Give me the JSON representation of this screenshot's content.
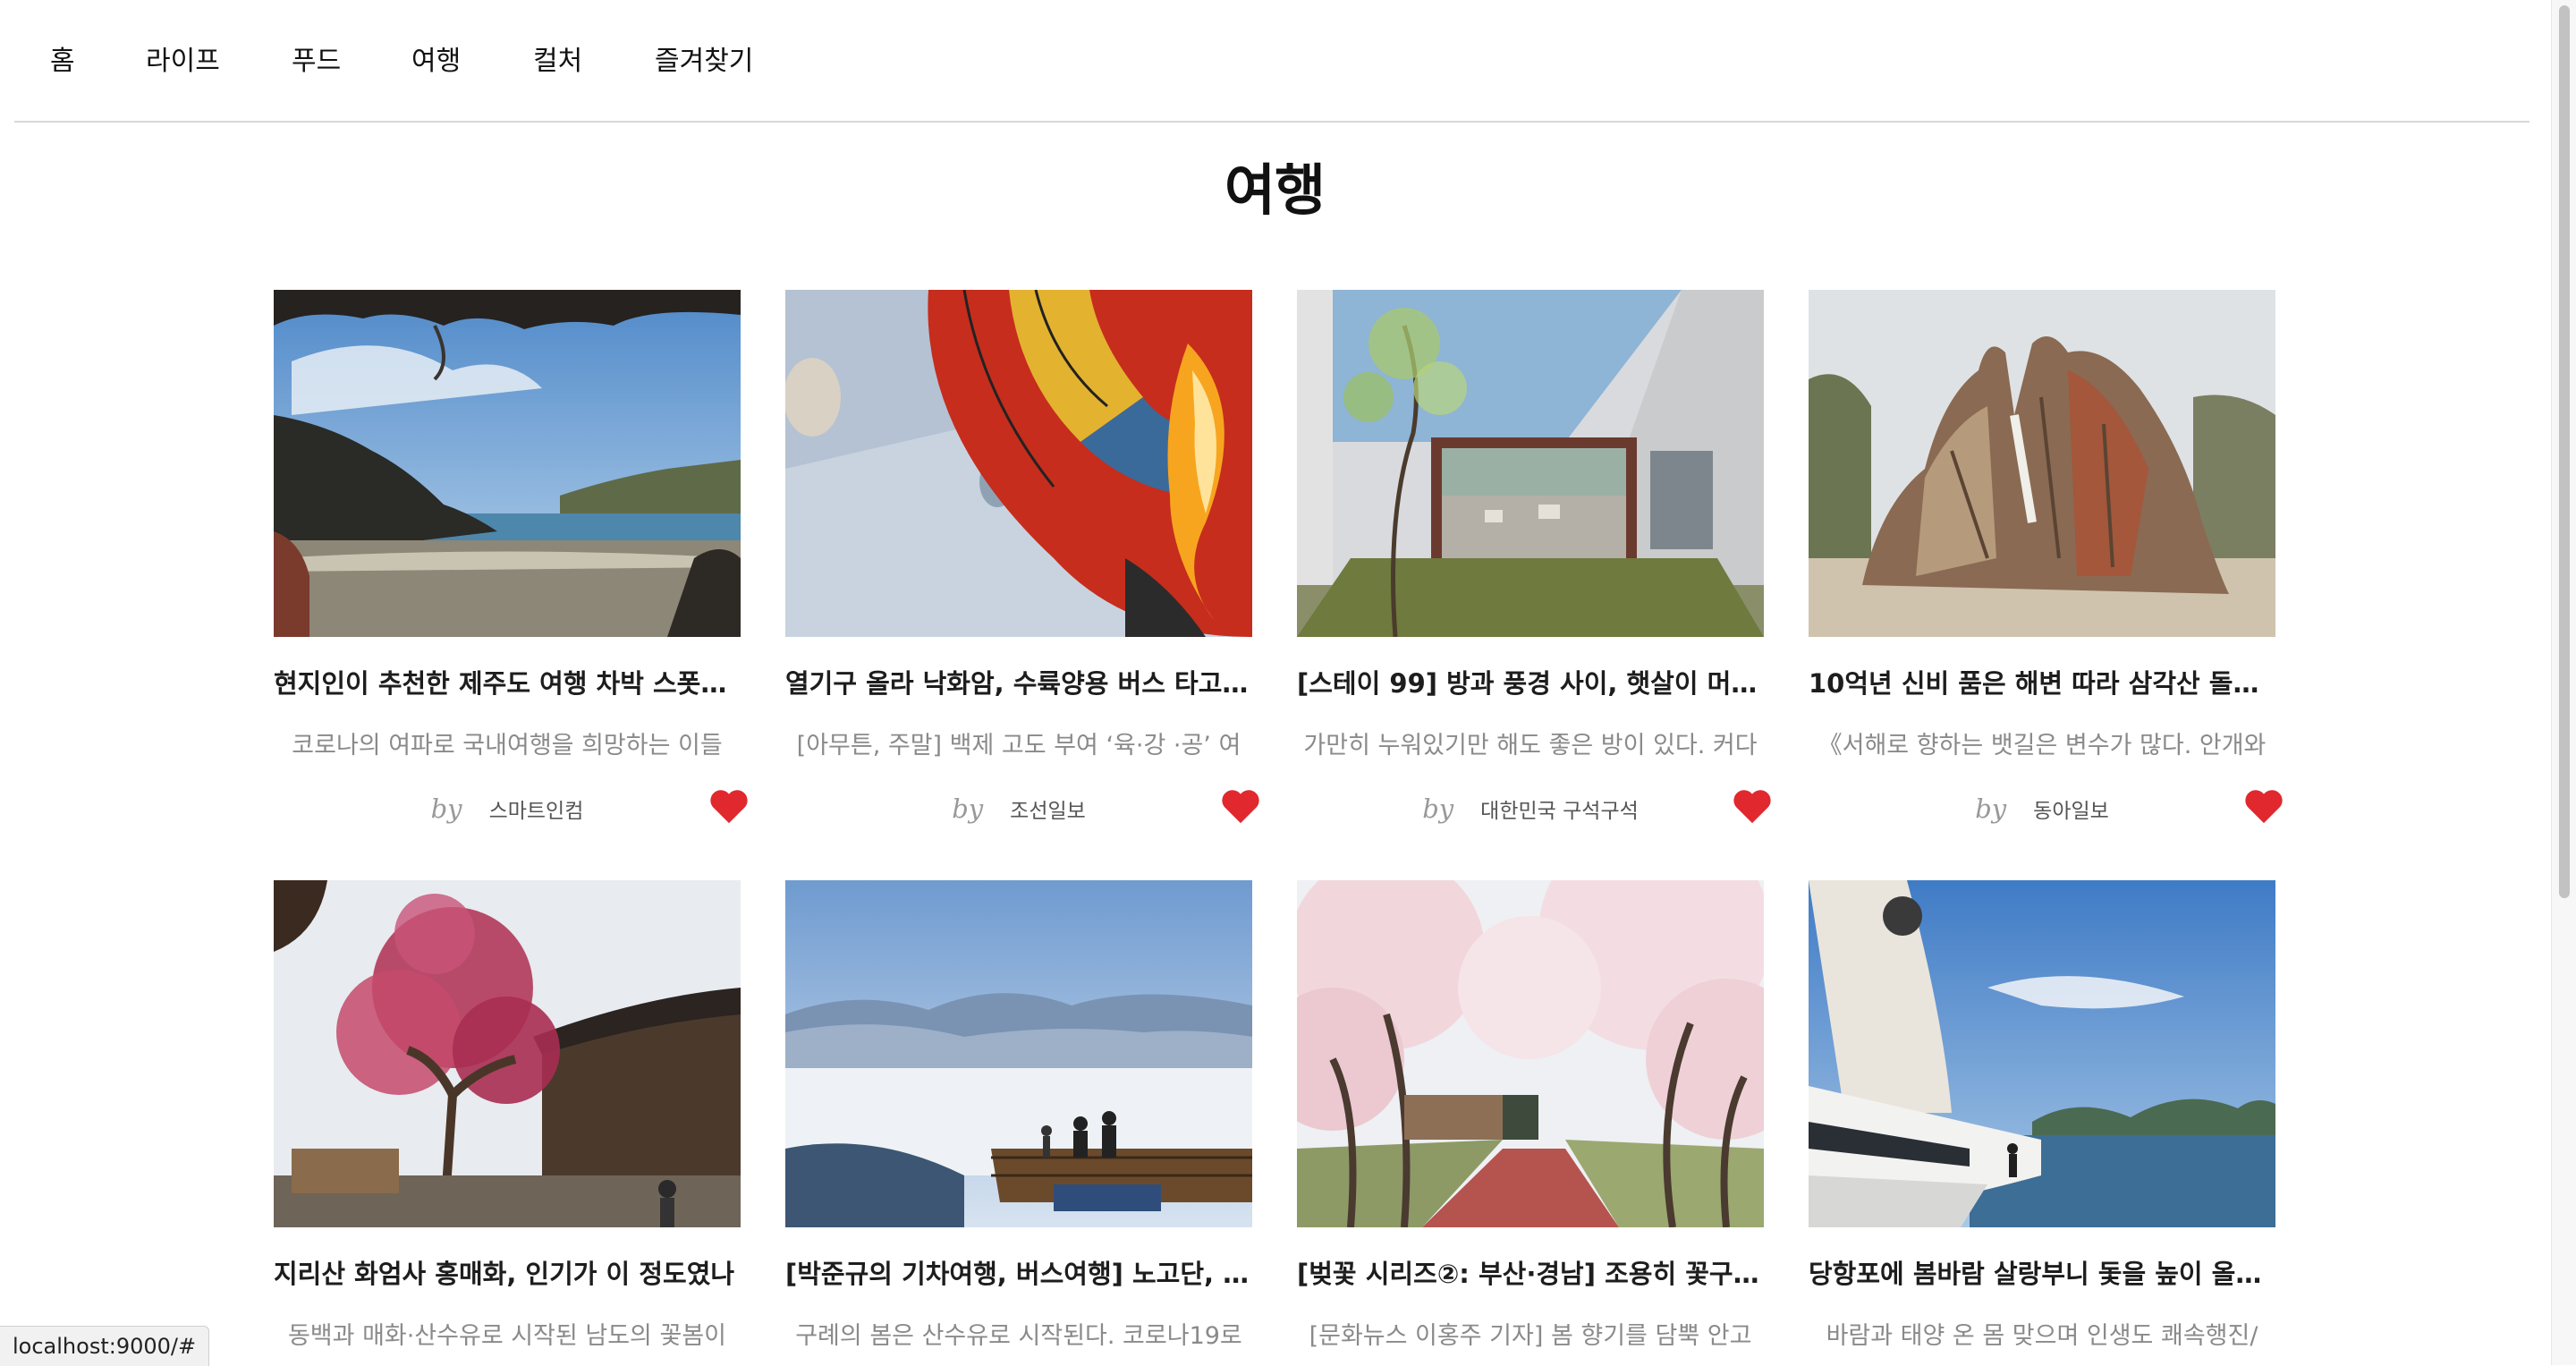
{
  "nav": {
    "items": [
      "홈",
      "라이프",
      "푸드",
      "여행",
      "컬처",
      "즐겨찾기"
    ]
  },
  "page": {
    "title": "여행"
  },
  "by_label": "by",
  "cards": [
    {
      "title": "현지인이 추천한 제주도 여행 차박 스폿…",
      "summary": "코로나의 여파로 국내여행을 희망하는 이들",
      "source": "스마트인컴",
      "liked": true
    },
    {
      "title": "열기구 올라 낙화암, 수륙양용 버스 타고…",
      "summary": "[아무튼, 주말] 백제 고도 부여 ‘육·강 ·공’ 여",
      "source": "조선일보",
      "liked": true
    },
    {
      "title": "[스테이 99] 방과 풍경 사이, 햇살이 머…",
      "summary": "가만히 누워있기만 해도 좋은 방이 있다. 커다",
      "source": "대한민국 구석구석",
      "liked": true
    },
    {
      "title": "10억년 신비 품은 해변 따라 삼각산 돌…",
      "summary": "《서해로 향하는 뱃길은 변수가 많다. 안개와",
      "source": "동아일보",
      "liked": true
    },
    {
      "title": "지리산 화엄사 홍매화, 인기가 이 정도였나",
      "summary": "동백과 매화·산수유로 시작된 남도의 꽃봄이",
      "source": "",
      "liked": true
    },
    {
      "title": "[박준규의 기차여행, 버스여행] 노고단, …",
      "summary": "구례의 봄은 산수유로 시작된다. 코로나19로",
      "source": "",
      "liked": true
    },
    {
      "title": "[벚꽃 시리즈②: 부산·경남] 조용히 꽃구…",
      "summary": "[문화뉴스 이홍주 기자] 봄 향기를 담뿍 안고",
      "source": "",
      "liked": true
    },
    {
      "title": "당항포에 봄바람 살랑부니 돛을 높이 올…",
      "summary": "바람과 태양 온 몸 맞으며 인생도 쾌속행진/",
      "source": "",
      "liked": true
    }
  ],
  "status_bar": {
    "url": "localhost:9000/#"
  },
  "colors": {
    "heart": "#e0282e",
    "divider": "#d7d7d7",
    "summary": "#8a8a8a"
  }
}
